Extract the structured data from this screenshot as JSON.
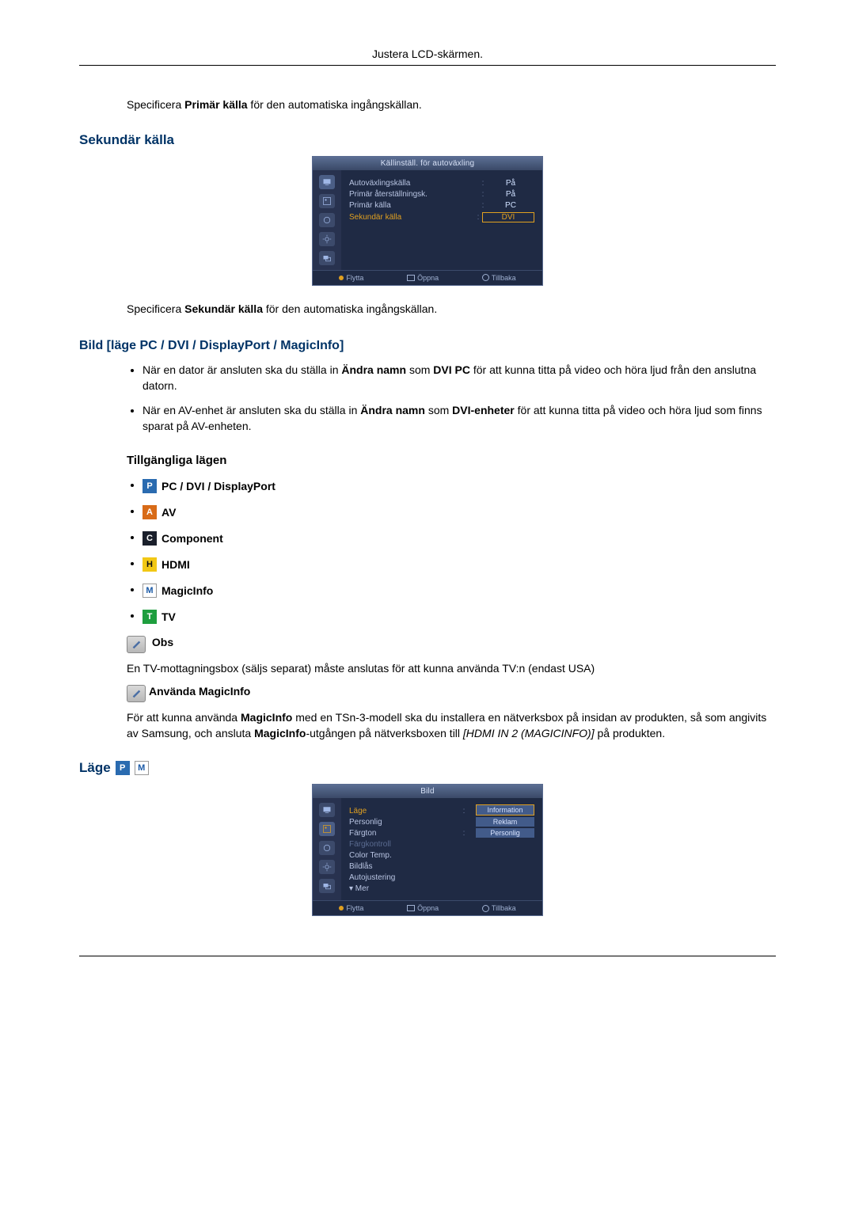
{
  "header": {
    "title": "Justera LCD-skärmen."
  },
  "section1": {
    "intro_pre": "Specificera ",
    "intro_bold": "Primär källa",
    "intro_post": "  för den automatiska ingångskällan.",
    "heading": "Sekundär källa",
    "osd": {
      "title": "Källinställ. för autoväxling",
      "rows": [
        {
          "label": "Autoväxlingskälla",
          "value": "På"
        },
        {
          "label": "Primär återställningsk.",
          "value": "På"
        },
        {
          "label": "Primär källa",
          "value": "PC"
        },
        {
          "label": "Sekundär källa",
          "value": "DVI",
          "highlight": true
        }
      ],
      "footer": {
        "move": "Flytta",
        "open": "Öppna",
        "back": "Tillbaka"
      }
    },
    "outro_pre": "Specificera ",
    "outro_bold": "Sekundär källa",
    "outro_post": "  för den automatiska ingångskällan."
  },
  "section2": {
    "heading": "Bild [läge PC / DVI / DisplayPort / MagicInfo]",
    "bullets": [
      {
        "pre": "När en dator är ansluten ska du ställa in ",
        "b1": "Ändra namn",
        "mid1": " som ",
        "b2": "DVI PC",
        "post": " för att kunna titta på video och höra ljud från den anslutna datorn."
      },
      {
        "pre": "När en AV-enhet är ansluten ska du ställa in ",
        "b1": "Ändra namn",
        "mid1": " som ",
        "b2": "DVI-enheter",
        "post": " för att kunna titta på video och höra ljud som finns sparat på AV-enheten."
      }
    ],
    "modes_heading": "Tillgängliga lägen",
    "modes": [
      {
        "badge": "P",
        "cls": "badge-P",
        "label": "PC / DVI / DisplayPort"
      },
      {
        "badge": "A",
        "cls": "badge-A",
        "label": "AV"
      },
      {
        "badge": "C",
        "cls": "badge-C",
        "label": "Component"
      },
      {
        "badge": "H",
        "cls": "badge-H",
        "label": "HDMI"
      },
      {
        "badge": "M",
        "cls": "badge-M",
        "label": "MagicInfo"
      },
      {
        "badge": "T",
        "cls": "badge-T",
        "label": "TV"
      }
    ],
    "obs_label": "Obs",
    "obs_text": "En TV-mottagningsbox (säljs separat) måste anslutas för att kunna använda TV:n (endast USA)",
    "use_mi_label": "Använda MagicInfo",
    "mi_text_pre": "För att kunna använda ",
    "mi_b1": "MagicInfo",
    "mi_mid1": " med en TSn-3-modell ska du installera en nätverksbox på insidan av produkten, så som angivits av Samsung, och ansluta ",
    "mi_b2": "MagicInfo",
    "mi_mid2": "-utgången på nätverksboxen till ",
    "mi_i": "[HDMI IN 2 (MAGICINFO)]",
    "mi_post": " på produkten."
  },
  "section3": {
    "heading": "Läge",
    "osd": {
      "title": "Bild",
      "left": [
        "Läge",
        "Personlig",
        "Färgton",
        "Färgkontroll",
        "Color Temp.",
        "Bildlås",
        "Autojustering",
        "▾ Mer"
      ],
      "right": [
        {
          "text": "Information",
          "sel": true
        },
        {
          "text": "Reklam"
        },
        {
          "text": "Personlig"
        }
      ],
      "footer": {
        "move": "Flytta",
        "open": "Öppna",
        "back": "Tillbaka"
      }
    }
  }
}
